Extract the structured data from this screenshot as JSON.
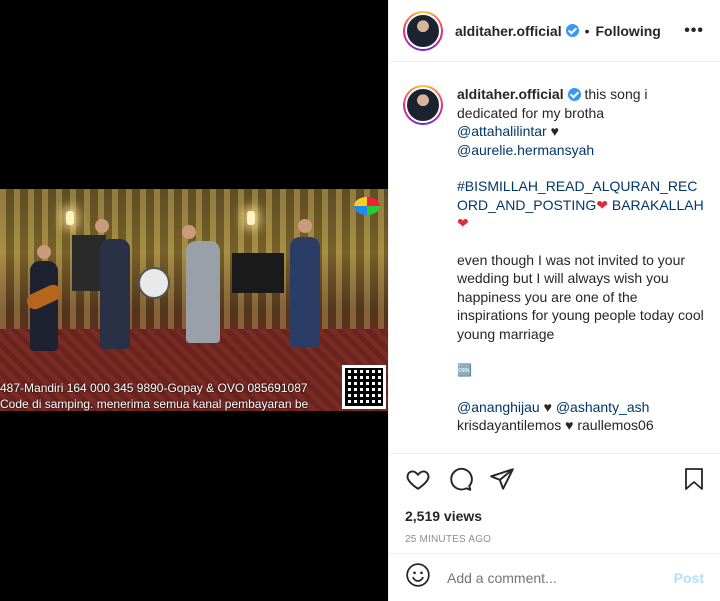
{
  "post": {
    "username": "alditaher.official",
    "follow_status": "Following",
    "dot": "•",
    "more": "•••"
  },
  "video": {
    "ticker_line1": "487-Mandiri 164 000 345 9890-Gopay & OVO 085691087",
    "ticker_line2": "Code di samping. menerima semua kanal pembayaran be"
  },
  "caption": {
    "username": "alditaher.official",
    "line1": "this song i dedicated for my brotha",
    "mention1": "@attahalilintar",
    "mention2": "@aurelie.hermansyah",
    "hashtag": "#BISMILLAH_READ_ALQURAN_RECORD_AND_POSTING",
    "hashtag2": "BARAKALLAH",
    "heart_red": "❤",
    "heart_black": "♥",
    "body": "even though I was not invited to your wedding but I will always wish you happiness you are one of the inspirations for young people today cool young marriage",
    "emoji": "🆒",
    "mention3": "@ananghijau",
    "mention4": "@ashanty_ash",
    "tag1": "krisdayantilemos",
    "tag2": "raullemos06",
    "trailing": ". ."
  },
  "stats": {
    "views": "2,519 views",
    "time": "25 MINUTES AGO"
  },
  "comment_box": {
    "placeholder": "Add a comment...",
    "post_label": "Post"
  },
  "icons": [
    "heart-icon",
    "comment-icon",
    "share-icon",
    "bookmark-icon",
    "emoji-icon",
    "verified-badge-icon"
  ]
}
